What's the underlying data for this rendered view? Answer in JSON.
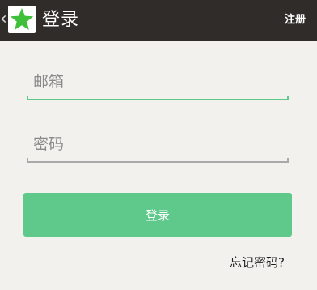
{
  "header": {
    "title": "登录",
    "register_label": "注册",
    "back_glyph": "‹",
    "logo_icon": "green-star-icon"
  },
  "form": {
    "email_placeholder": "邮箱",
    "email_value": "",
    "password_placeholder": "密码",
    "password_value": "",
    "login_label": "登录",
    "forgot_label": "忘记密码?"
  },
  "colors": {
    "topbar": "#302c2a",
    "background": "#f2f1ee",
    "accent": "#5ec98a",
    "email_underline_active": "#5ec98a",
    "password_underline": "#a9a9a9",
    "logo_star": "#3fbf3a"
  }
}
